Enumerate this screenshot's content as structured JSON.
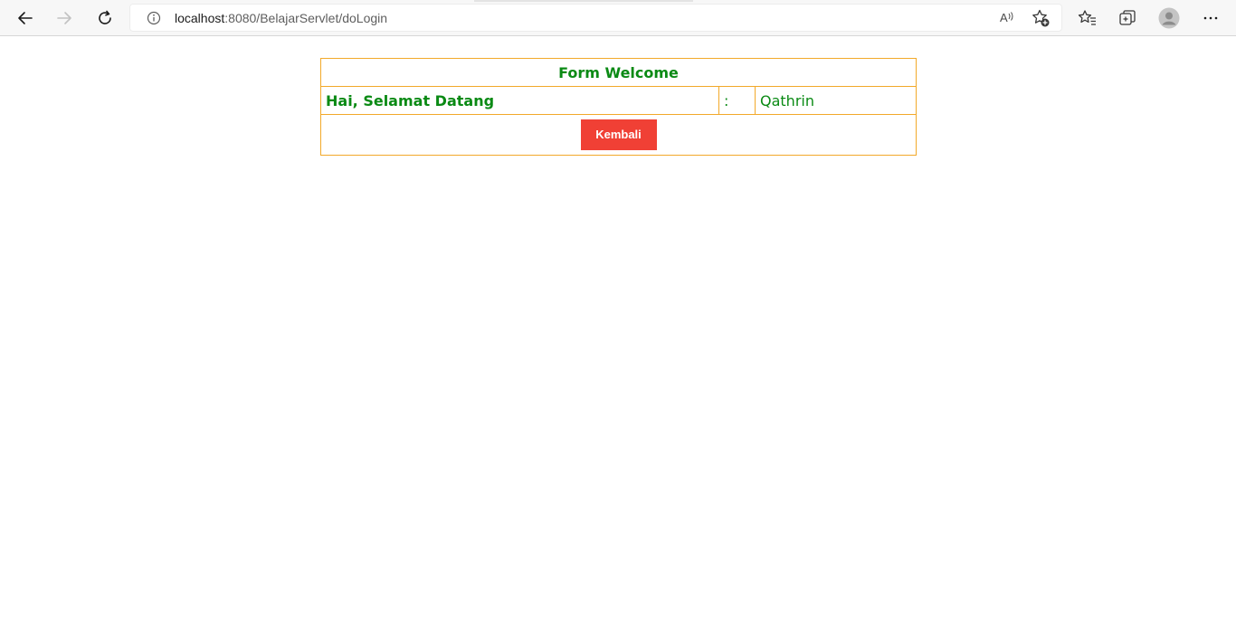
{
  "browser": {
    "url_host": "localhost",
    "url_path": ":8080/BelajarServlet/doLogin",
    "icons": {
      "back": "back-arrow-icon",
      "forward": "forward-arrow-icon",
      "refresh": "refresh-icon",
      "info": "info-icon",
      "read_aloud": "read-aloud-icon",
      "add_favorite": "add-favorite-icon",
      "favorites": "favorites-icon",
      "collections": "collections-icon",
      "profile": "profile-avatar-icon",
      "menu": "more-menu-icon"
    }
  },
  "form": {
    "title": "Form Welcome",
    "greeting_label": "Hai, Selamat Datang",
    "separator": ":",
    "username": "Qathrin",
    "back_button": "Kembali"
  },
  "colors": {
    "text_green": "#0a8a14",
    "border_orange": "#f2a92a",
    "button_red": "#f04035"
  }
}
